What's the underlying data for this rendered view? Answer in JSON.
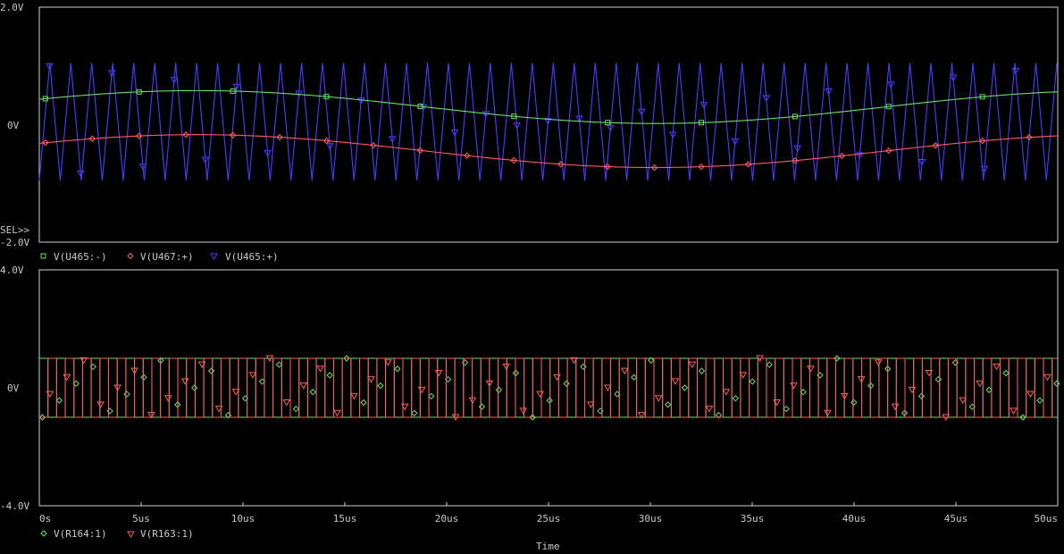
{
  "time_label": "Time",
  "sel_marker": "SEL>>",
  "colors": {
    "green": "#66e066",
    "red": "#ff5c5c",
    "blue": "#4b3cff",
    "frame": "#d0d0d0",
    "text": "#c8c8c8"
  },
  "chart_data": [
    {
      "type": "line",
      "title": "",
      "xlabel": "Time",
      "ylabel": "",
      "xlim_us": [
        0,
        50
      ],
      "ylim": [
        -2,
        2
      ],
      "yticks": [
        "2.0V",
        "0V",
        "-2.0V"
      ],
      "xticks": [],
      "series": [
        {
          "name": "V(U465:-)",
          "color": "#66e066",
          "marker": "square",
          "shape": "sine",
          "offset": 0.3,
          "amplitude": 0.28,
          "period_us": 45,
          "phase_deg": 28,
          "x_us": [
            0,
            5,
            10,
            15,
            20,
            25,
            30,
            35,
            40,
            45,
            50
          ],
          "values": [
            0.45,
            0.6,
            0.7,
            0.7,
            0.6,
            0.45,
            0.3,
            0.15,
            0.1,
            0.2,
            0.4
          ]
        },
        {
          "name": "V(U467:+)",
          "color": "#ff5c5c",
          "marker": "diamond",
          "shape": "sine",
          "offset": -0.45,
          "amplitude": 0.28,
          "period_us": 45,
          "phase_deg": 28,
          "x_us": [
            0,
            5,
            10,
            15,
            20,
            25,
            30,
            35,
            40,
            45,
            50
          ],
          "values": [
            -0.4,
            -0.25,
            -0.15,
            -0.15,
            -0.25,
            -0.4,
            -0.55,
            -0.7,
            -0.72,
            -0.6,
            -0.4
          ]
        },
        {
          "name": "V(U465:+)",
          "color": "#4b3cff",
          "marker": "triangle-down",
          "shape": "triangle",
          "min": -0.95,
          "max": 1.05,
          "period_us": 1.03,
          "values": [
            -0.95,
            1.05
          ]
        }
      ]
    },
    {
      "type": "line",
      "title": "",
      "xlabel": "Time",
      "ylabel": "",
      "xlim_us": [
        0,
        50
      ],
      "ylim": [
        -4,
        4
      ],
      "yticks": [
        "4.0V",
        "0V",
        "-4.0V"
      ],
      "xticks": [
        "0s",
        "5us",
        "10us",
        "15us",
        "20us",
        "25us",
        "30us",
        "35us",
        "40us",
        "45us",
        "50us"
      ],
      "series": [
        {
          "name": "V(R164:1)",
          "color": "#66e066",
          "marker": "diamond",
          "shape": "square",
          "low": -1.0,
          "high": 1.0,
          "period_us": 0.85,
          "duty": 0.5,
          "phase_us": 0
        },
        {
          "name": "V(R163:1)",
          "color": "#ff5c5c",
          "marker": "triangle-down",
          "shape": "square",
          "low": -1.0,
          "high": 1.0,
          "period_us": 0.85,
          "duty": 0.5,
          "phase_us": 0.425
        }
      ]
    }
  ]
}
